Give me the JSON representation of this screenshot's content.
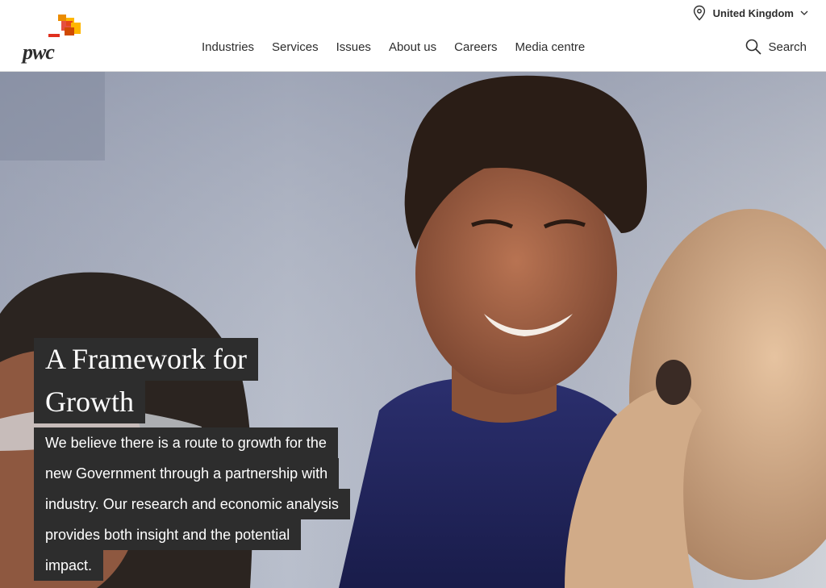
{
  "header": {
    "logo_text": "pwc",
    "country": "United Kingdom",
    "nav": [
      "Industries",
      "Services",
      "Issues",
      "About us",
      "Careers",
      "Media centre"
    ],
    "search_label": "Search"
  },
  "hero": {
    "title_lines": [
      "A Framework for",
      "Growth"
    ],
    "body_lines": [
      "We believe there is a route to growth for the",
      "new Government through a partnership with",
      "industry. Our research and economic analysis",
      "provides both insight and the potential",
      "impact."
    ]
  },
  "colors": {
    "accent_orange": "#e0301e",
    "text_dark": "#2d2d2d",
    "caption_bg": "#2d2d2d"
  }
}
